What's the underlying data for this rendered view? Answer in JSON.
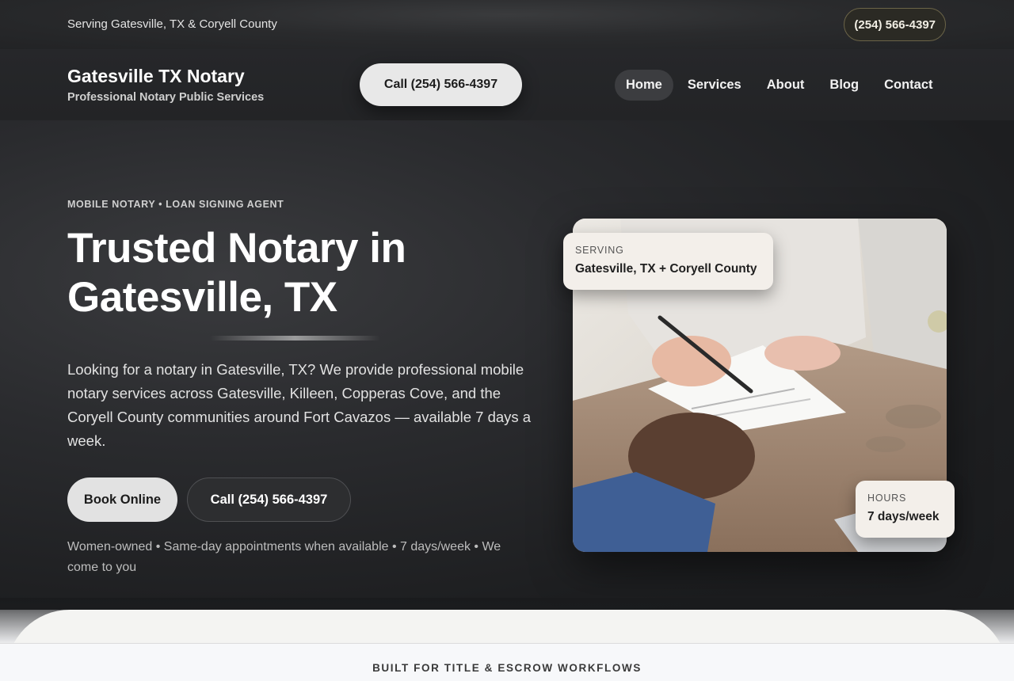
{
  "topbar": {
    "service_area": "Serving Gatesville, TX & Coryell County",
    "phone": "(254) 566-4397"
  },
  "header": {
    "brand_title": "Gatesville TX Notary",
    "brand_subtitle": "Professional Notary Public Services",
    "call_button": "Call (254) 566-4397",
    "nav": [
      {
        "label": "Home",
        "active": true
      },
      {
        "label": "Services",
        "active": false
      },
      {
        "label": "About",
        "active": false
      },
      {
        "label": "Blog",
        "active": false
      },
      {
        "label": "Contact",
        "active": false
      }
    ]
  },
  "hero": {
    "eyebrow": "MOBILE NOTARY • LOAN SIGNING AGENT",
    "title_line1": "Trusted Notary in",
    "title_line2": "Gatesville, TX",
    "description": "Looking for a notary in Gatesville, TX? We provide professional mobile notary services across Gatesville, Killeen, Copperas Cove, and the Coryell County communities around Fort Cavazos — available 7 days a week.",
    "book_button": "Book Online",
    "call_button": "Call (254) 566-4397",
    "notes": "Women-owned • Same-day appointments when available • 7 days/week • We come to you"
  },
  "badges": {
    "serving_label": "SERVING",
    "serving_value": "Gatesville, TX + Coryell County",
    "hours_label": "HOURS",
    "hours_value": "7 days/week"
  },
  "next_section": {
    "label": "BUILT FOR TITLE & ESCROW WORKFLOWS"
  },
  "colors": {
    "background": "#1e1f21",
    "primary_button": "#e2e2e2",
    "badge_bg": "#f3efea",
    "topbar_phone_border": "#6b6448"
  }
}
